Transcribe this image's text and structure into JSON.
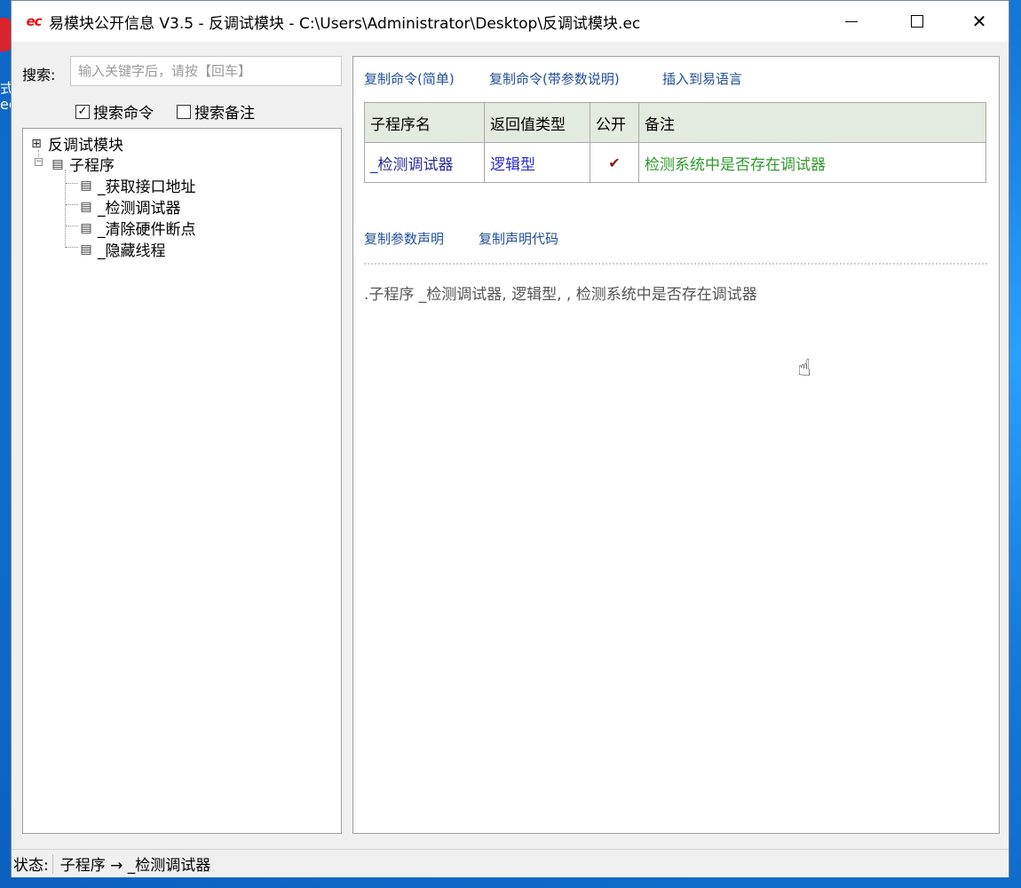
{
  "window": {
    "logo": "ec",
    "title": "易模块公开信息 V3.5 - 反调试模块 - C:\\Users\\Administrator\\Desktop\\反调试模块.ec",
    "close_glyph": "✕"
  },
  "desktop": {
    "label_1": "式",
    "label_2": "ec"
  },
  "search": {
    "label": "搜索:",
    "placeholder": "输入关键字后，请按【回车】",
    "value": ""
  },
  "options": {
    "search_commands": {
      "label": "搜索命令",
      "checked": true,
      "mark": "✓"
    },
    "search_notes": {
      "label": "搜索备注",
      "checked": false
    }
  },
  "tree": {
    "root": "反调试模块",
    "group": "子程序",
    "items": [
      "_获取接口地址",
      "_检测调试器",
      "_清除硬件断点",
      "_隐藏线程"
    ],
    "selected_index": 1
  },
  "links_top": [
    "复制命令(简单)",
    "复制命令(带参数说明)",
    "插入到易语言"
  ],
  "table": {
    "headers": [
      "子程序名",
      "返回值类型",
      "公开",
      "备注"
    ],
    "row": {
      "name": "_检测调试器",
      "type": "逻辑型",
      "public": "✔",
      "note": "检测系统中是否存在调试器"
    }
  },
  "links_mid": [
    "复制参数声明",
    "复制声明代码"
  ],
  "declaration": ".子程序 _检测调试器, 逻辑型, , 检测系统中是否存在调试器",
  "status": {
    "label": "状态:",
    "text": "子程序 → _检测调试器"
  },
  "icons": {
    "module": "module-icon",
    "group": "book-icon",
    "item": "sub-icon"
  }
}
